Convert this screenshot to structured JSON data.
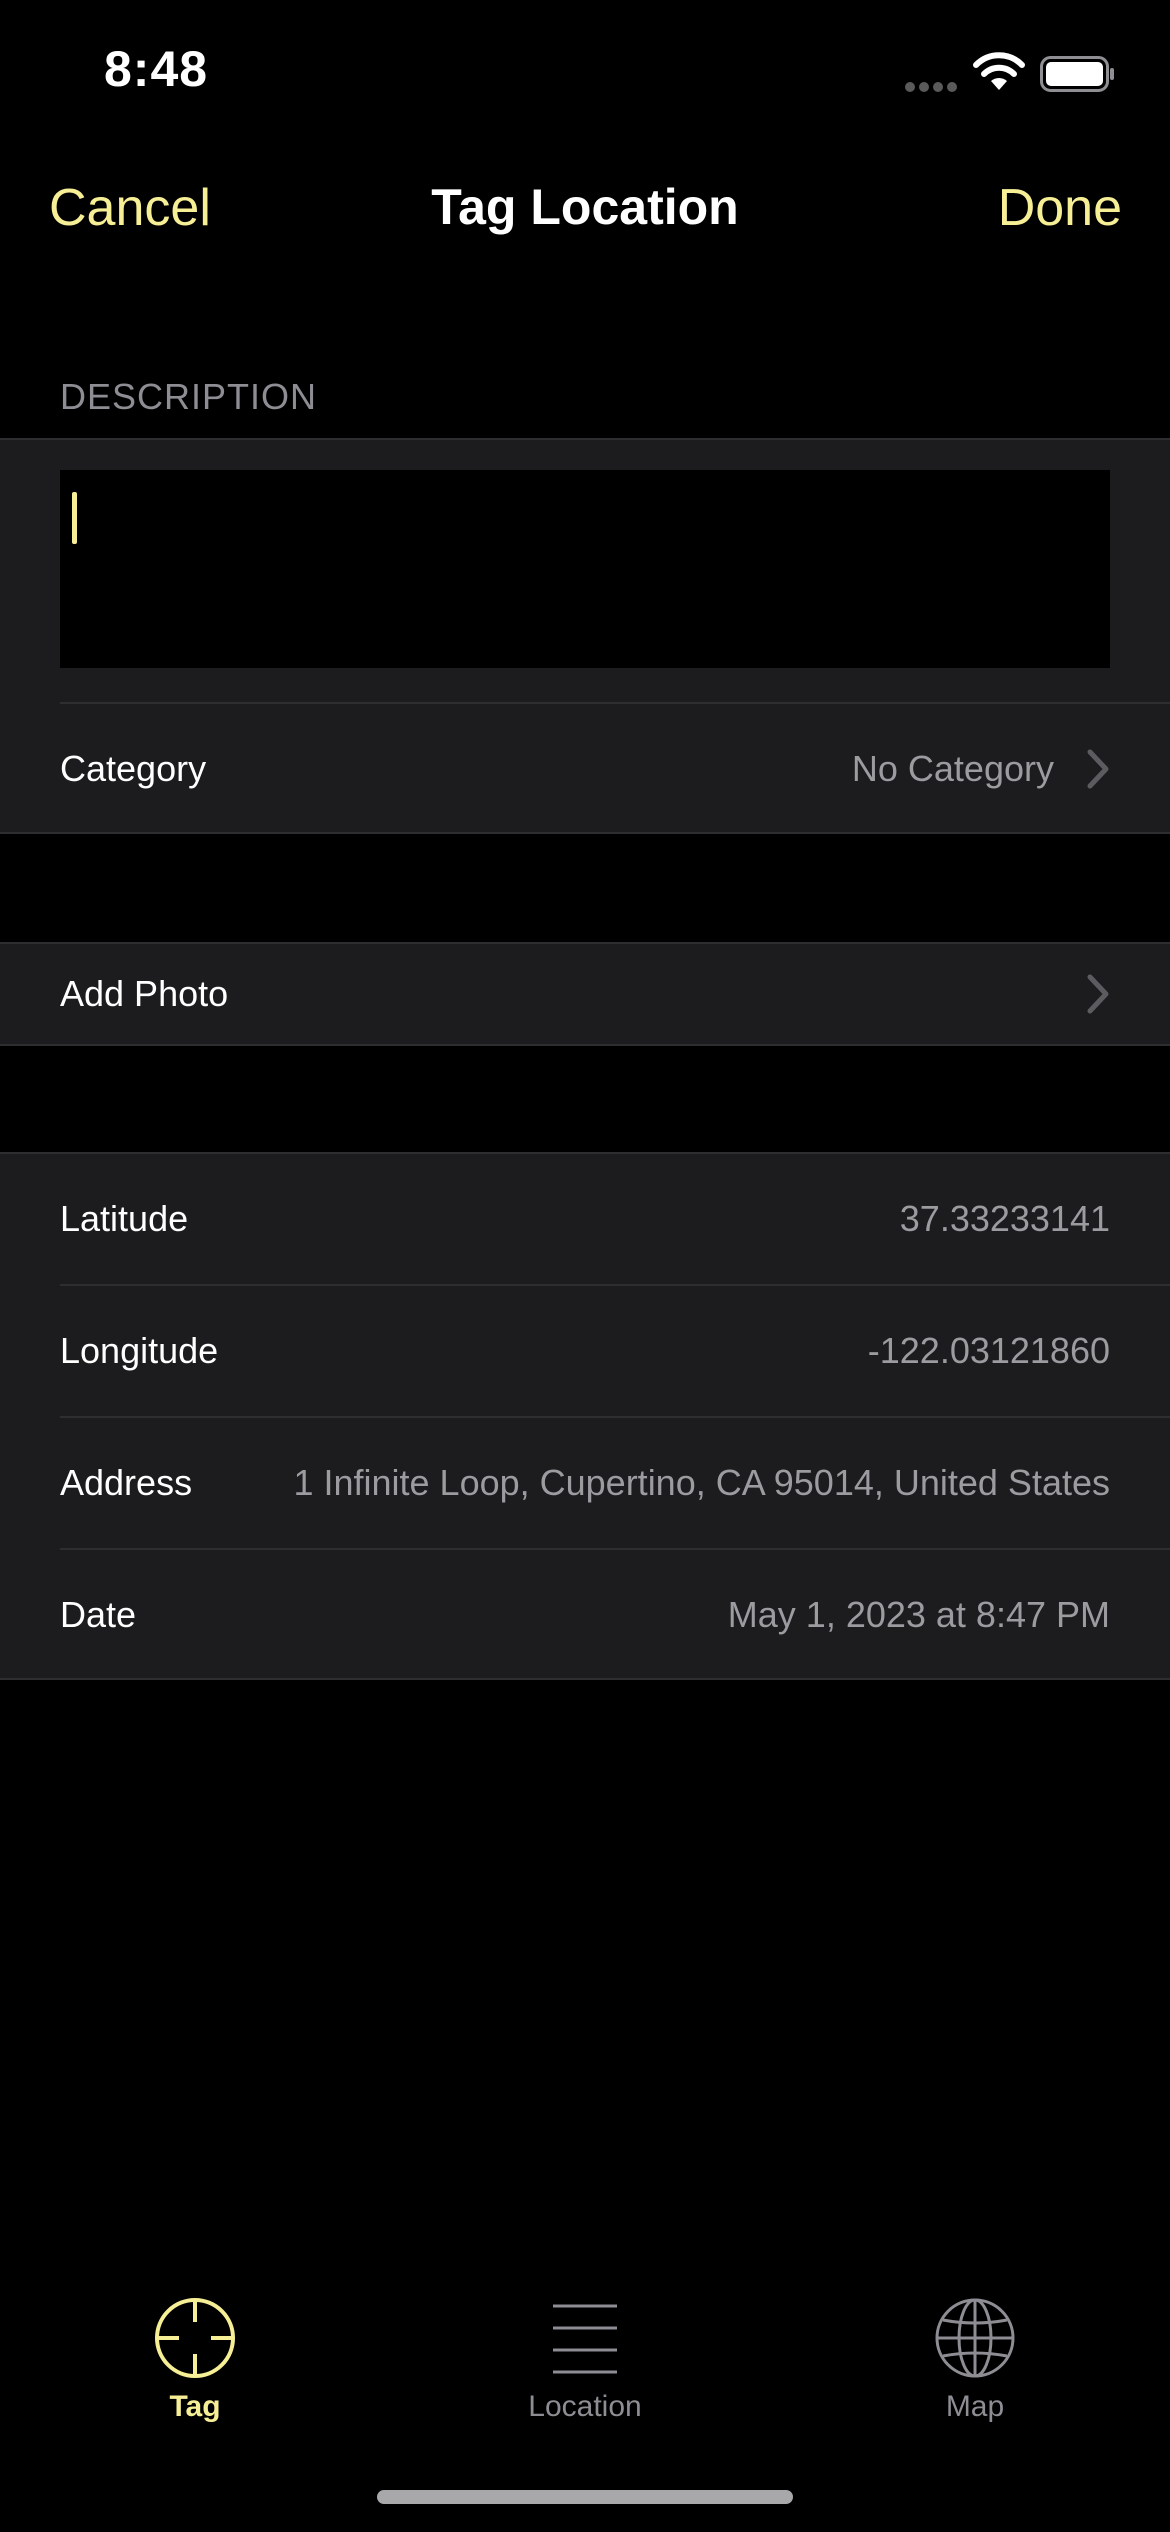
{
  "status_bar": {
    "time": "8:48"
  },
  "nav": {
    "cancel_label": "Cancel",
    "title": "Tag Location",
    "done_label": "Done"
  },
  "description": {
    "header": "DESCRIPTION",
    "value": ""
  },
  "category": {
    "label": "Category",
    "value": "No Category"
  },
  "photo": {
    "label": "Add Photo"
  },
  "details": {
    "latitude_label": "Latitude",
    "latitude_value": "37.33233141",
    "longitude_label": "Longitude",
    "longitude_value": "-122.03121860",
    "address_label": "Address",
    "address_value": "1 Infinite Loop, Cupertino, CA 95014, United States",
    "date_label": "Date",
    "date_value": "May 1, 2023 at 8:47 PM"
  },
  "tabs": [
    {
      "label": "Tag",
      "icon": "crosshair-icon",
      "selected": true
    },
    {
      "label": "Location",
      "icon": "list-icon",
      "selected": false
    },
    {
      "label": "Map",
      "icon": "globe-icon",
      "selected": false
    }
  ],
  "colors": {
    "accent": "#f7ef96",
    "background": "#000000",
    "cell": "#1c1c1e",
    "secondary_text": "#9b9ba0",
    "inactive_tab": "#8d8d93"
  }
}
